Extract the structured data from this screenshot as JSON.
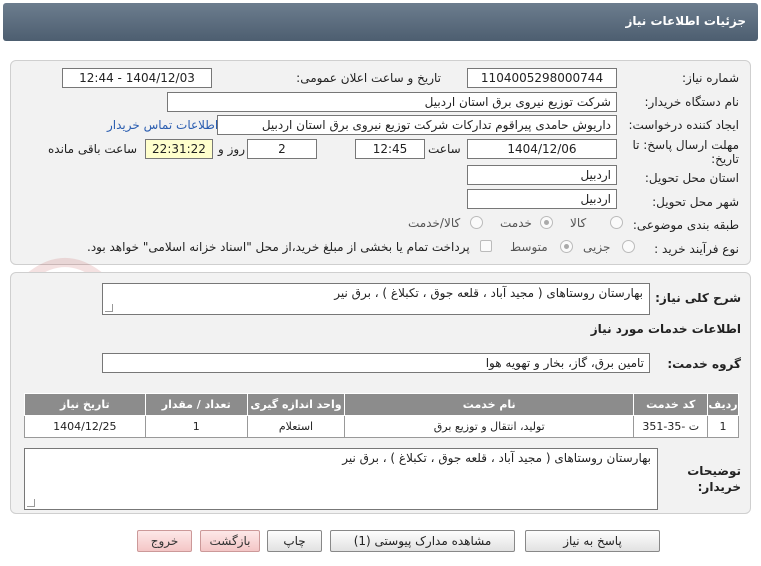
{
  "window": {
    "title": "جزئیات اطلاعات نیاز"
  },
  "form": {
    "need_number_label": "شماره نیاز:",
    "need_number": "1104005298000744",
    "announce_label": "تاریخ و ساعت اعلان عمومی:",
    "announce_value": "1404/12/03 - 12:44",
    "buyer_label": "نام دستگاه خریدار:",
    "buyer_value": "شرکت توزیع نیروی برق استان اردبیل",
    "creator_label": "ایجاد کننده درخواست:",
    "creator_value": "داریوش حامدی پیراقوم تدارکات شرکت توزیع نیروی برق استان اردبیل",
    "contact_link": "اطلاعات تماس خریدار",
    "deadline_label_1": "مهلت ارسال پاسخ: تا",
    "deadline_label_2": "تاریخ:",
    "deadline_date": "1404/12/06",
    "time_label": "ساعت",
    "deadline_time": "12:45",
    "days_value": "2",
    "days_label": "روز و",
    "remaining_time": "22:31:22",
    "remaining_label": "ساعت باقی مانده",
    "province_label": "استان محل تحویل:",
    "province_value": "اردبیل",
    "city_label": "شهر محل تحویل:",
    "city_value": "اردبیل",
    "category_label": "طبقه بندی موضوعی:",
    "category_options": [
      "کالا",
      "خدمت",
      "کالا/خدمت"
    ],
    "category_selected": "خدمت",
    "process_label": "نوع فرآیند خرید :",
    "process_options": [
      "جزیی",
      "متوسط"
    ],
    "process_selected": "متوسط",
    "payment_note": "پرداخت تمام یا بخشی از مبلغ خرید،از محل \"اسناد خزانه اسلامی\" خواهد بود."
  },
  "summary": {
    "label": "شرح کلی نیاز:",
    "value": "بهارستان روستاهای ( مجید آباد ، قلعه جوق ، تکبلاغ ) ، برق نیر"
  },
  "services": {
    "section_title": "اطلاعات خدمات مورد نیاز",
    "group_label": "گروه خدمت:",
    "group_value": "تامین برق، گاز، بخار و تهویه هوا",
    "columns": [
      "ردیف",
      "کد خدمت",
      "نام خدمت",
      "واحد اندازه گیری",
      "تعداد / مقدار",
      "تاریخ نیاز"
    ],
    "rows": [
      [
        "1",
        "ت -35-351",
        "تولید، انتقال و توزیع برق",
        "استعلام",
        "1",
        "1404/12/25"
      ]
    ]
  },
  "buyer_notes": {
    "label_1": "توضیحات",
    "label_2": "خریدار:",
    "value": "بهارستان روستاهای ( مجید آباد ، قلعه جوق ، تکبلاغ ) ، برق نیر"
  },
  "buttons": {
    "reply": "پاسخ به نیاز",
    "attachments": "مشاهده مدارک پیوستی (1)",
    "print": "چاپ",
    "back": "بازگشت",
    "exit": "خروج"
  },
  "watermark": "AriaTender.net"
}
